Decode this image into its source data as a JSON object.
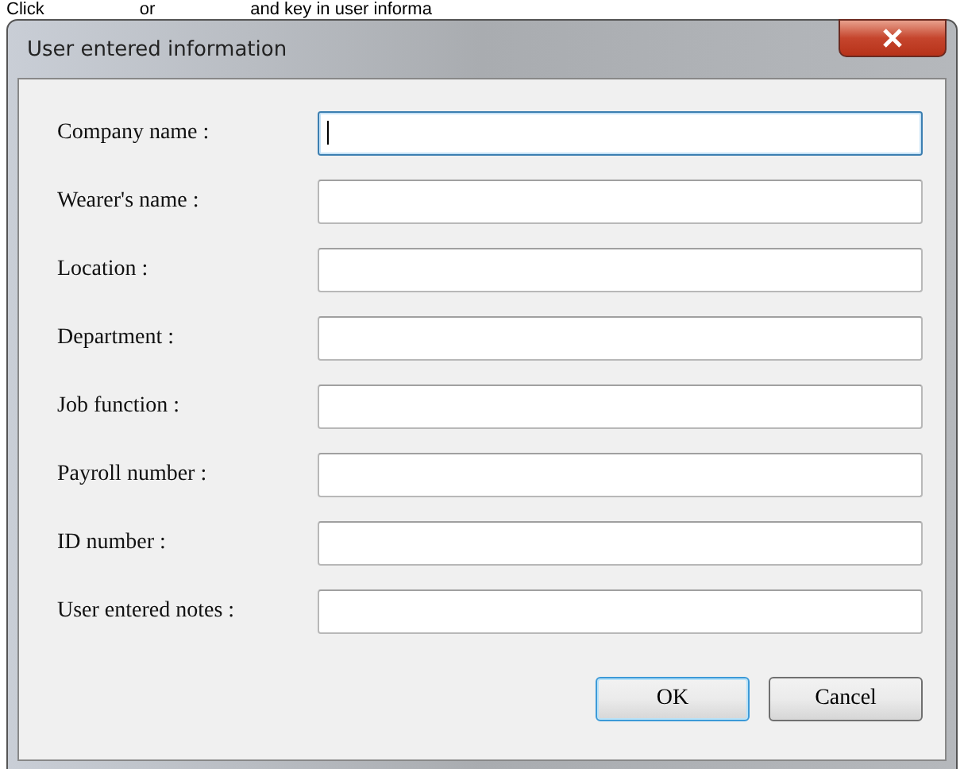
{
  "instruction": [
    "Click",
    "or",
    "and key in user informa"
  ],
  "window": {
    "title": "User entered information"
  },
  "fields": [
    {
      "label": "Company name :",
      "focused": true
    },
    {
      "label": "Wearer's name :",
      "focused": false
    },
    {
      "label": "Location :",
      "focused": false
    },
    {
      "label": "Department :",
      "focused": false
    },
    {
      "label": "Job function :",
      "focused": false
    },
    {
      "label": "Payroll number :",
      "focused": false
    },
    {
      "label": "ID number :",
      "focused": false
    },
    {
      "label": "User entered notes :",
      "focused": false
    }
  ],
  "buttons": [
    {
      "label": "OK",
      "default": true
    },
    {
      "label": "Cancel",
      "default": false
    }
  ]
}
